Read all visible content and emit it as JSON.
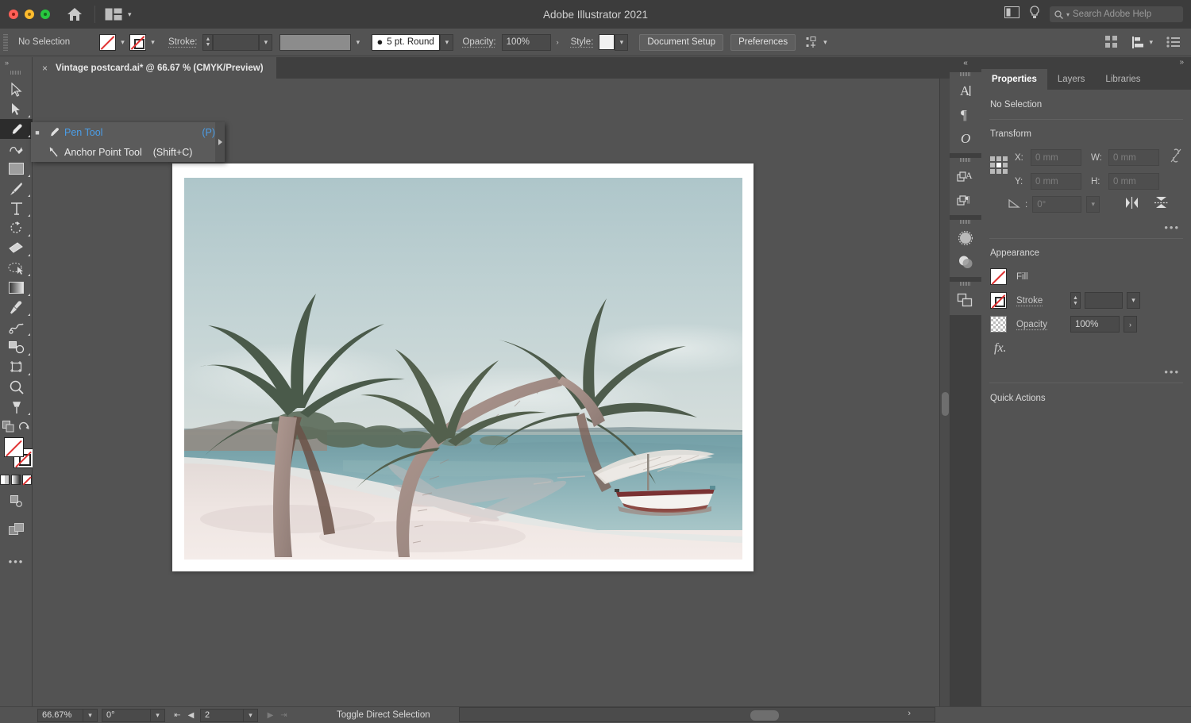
{
  "app": {
    "title": "Adobe Illustrator 2021",
    "window_controls": [
      "close",
      "minimize",
      "maximize"
    ],
    "home_icon": "home-icon",
    "arrange_documents_icon": "arrange-documents-icon",
    "workspace_switcher_icon": "workspace-panel-icon",
    "help_icon": "lightbulb-help-icon",
    "search": {
      "placeholder": "Search Adobe Help",
      "icon": "search-icon"
    }
  },
  "control_bar": {
    "selection_status": "No Selection",
    "fill_swatch": "none",
    "stroke_swatch": "none",
    "stroke_label": "Stroke:",
    "stroke_weight": "",
    "stroke_profile": "",
    "brush_definition": "5 pt. Round",
    "opacity_label": "Opacity:",
    "opacity_value": "100%",
    "style_label": "Style:",
    "document_setup": "Document Setup",
    "preferences": "Preferences",
    "align_icon": "align-distribute-icon",
    "arrange_grid_icon": "arrange-grid-icon",
    "options_list_icon": "options-list-icon"
  },
  "document_tab": {
    "close": "×",
    "title": "Vintage postcard.ai* @ 66.67 % (CMYK/Preview)"
  },
  "toolbar": {
    "expand_icon": "expand-toolbar-chevron",
    "tools": [
      {
        "name": "selection-tool",
        "icon": "arrow-outline-icon",
        "selected": false,
        "flyout": false
      },
      {
        "name": "direct-selection-tool",
        "icon": "arrow-solid-icon",
        "selected": false,
        "flyout": true
      },
      {
        "name": "pen-tool",
        "icon": "pen-nib-icon",
        "selected": true,
        "flyout": true
      },
      {
        "name": "curvature-tool",
        "icon": "curvature-icon",
        "selected": false,
        "flyout": false
      },
      {
        "name": "rectangle-tool",
        "icon": "rectangle-icon",
        "selected": false,
        "flyout": true
      },
      {
        "name": "paintbrush-tool",
        "icon": "paintbrush-icon",
        "selected": false,
        "flyout": true
      },
      {
        "name": "type-tool",
        "icon": "type-t-icon",
        "selected": false,
        "flyout": true
      },
      {
        "name": "rotate-tool",
        "icon": "rotate-icon",
        "selected": false,
        "flyout": true
      },
      {
        "name": "eraser-tool",
        "icon": "eraser-icon",
        "selected": false,
        "flyout": true
      },
      {
        "name": "shape-builder-tool",
        "icon": "shape-builder-icon",
        "selected": false,
        "flyout": true
      },
      {
        "name": "gradient-tool",
        "icon": "gradient-icon",
        "selected": false,
        "flyout": true
      },
      {
        "name": "eyedropper-tool",
        "icon": "eyedropper-icon",
        "selected": false,
        "flyout": true
      },
      {
        "name": "symbol-sprayer-tool",
        "icon": "symbol-sprayer-icon",
        "selected": false,
        "flyout": true
      },
      {
        "name": "free-transform-tool",
        "icon": "free-transform-icon",
        "selected": false,
        "flyout": true
      },
      {
        "name": "artboard-tool",
        "icon": "artboard-icon",
        "selected": false,
        "flyout": true
      },
      {
        "name": "zoom-tool",
        "icon": "magnifier-icon",
        "selected": false,
        "flyout": false
      },
      {
        "name": "hand-tool",
        "icon": "pin-hand-icon",
        "selected": false,
        "flyout": true
      }
    ],
    "swap_fill_stroke_icon": "swap-fill-stroke-icon",
    "default_fill_stroke_icon": "default-fill-stroke-icon",
    "fill_swatch": "none",
    "stroke_swatch": "none",
    "color_modes": [
      "color-swatch",
      "gradient-swatch",
      "none-swatch"
    ],
    "drawing_mode_icon": "draw-normal-icon",
    "screen_mode_icon": "screen-mode-icon",
    "more_tools_icon": "more-tools-ellipsis"
  },
  "flyout_menu": {
    "items": [
      {
        "label": "Pen Tool",
        "shortcut": "(P)",
        "icon": "pen-nib-icon",
        "selected": true
      },
      {
        "label": "Anchor Point Tool",
        "shortcut": "(Shift+C)",
        "icon": "anchor-point-icon",
        "selected": false
      }
    ]
  },
  "dock_strip": {
    "collapse_icon": "collapse-panels-chevron",
    "groups": [
      [
        {
          "name": "character-panel-icon",
          "glyph": "A"
        },
        {
          "name": "paragraph-panel-icon",
          "glyph": "¶"
        },
        {
          "name": "glyphs-panel-icon",
          "glyph": "O"
        }
      ],
      [
        {
          "name": "character-styles-panel-icon",
          "glyph": "A"
        },
        {
          "name": "paragraph-styles-panel-icon",
          "glyph": "¶"
        }
      ],
      [
        {
          "name": "brushes-panel-icon",
          "glyph": ""
        },
        {
          "name": "transparency-panel-icon",
          "glyph": ""
        }
      ],
      [
        {
          "name": "artboards-panel-icon",
          "glyph": ""
        }
      ]
    ]
  },
  "properties_panel": {
    "expand_icon": "expand-panel-chevrons",
    "tabs": [
      {
        "label": "Properties",
        "active": true
      },
      {
        "label": "Layers",
        "active": false
      },
      {
        "label": "Libraries",
        "active": false
      }
    ],
    "selection_status": "No Selection",
    "transform": {
      "title": "Transform",
      "reference_point_icon": "reference-point-grid",
      "x_label": "X:",
      "x_value": "0 mm",
      "y_label": "Y:",
      "y_value": "0 mm",
      "w_label": "W:",
      "w_value": "0 mm",
      "h_label": "H:",
      "h_value": "0 mm",
      "link_icon": "unlink-proportions-icon",
      "angle_label": "∠:",
      "angle_value": "0°",
      "flip_horizontal_icon": "flip-horizontal-icon",
      "flip_vertical_icon": "flip-vertical-icon",
      "more_options_icon": "more-options-ellipsis"
    },
    "appearance": {
      "title": "Appearance",
      "fill_label": "Fill",
      "fill_swatch": "none",
      "stroke_label": "Stroke",
      "stroke_swatch": "none",
      "stroke_weight": "",
      "opacity_label": "Opacity",
      "opacity_swatch": "checkerboard",
      "opacity_value": "100%",
      "effects_icon": "fx-effects-icon",
      "more_options_icon": "more-options-ellipsis"
    },
    "quick_actions": {
      "title": "Quick Actions"
    }
  },
  "status_bar": {
    "zoom_value": "66.67%",
    "rotation_value": "0°",
    "first_artboard_icon": "first-artboard-icon",
    "prev_artboard_icon": "prev-artboard-icon",
    "artboard_number": "2",
    "next_artboard_icon": "next-artboard-icon",
    "last_artboard_icon": "last-artboard-icon",
    "status_text": "Toggle Direct Selection",
    "status_menu_icon": "status-menu-arrow",
    "status_back_icon": "status-back-chevron",
    "scroll_right_icon": "scroll-right-chevron"
  },
  "artwork": {
    "name": "vintage-beach-postcard-photo",
    "description": "Vintage-toned photo of palm trees leaning over a pale sand beach with a small sailboat in turquoise water"
  }
}
